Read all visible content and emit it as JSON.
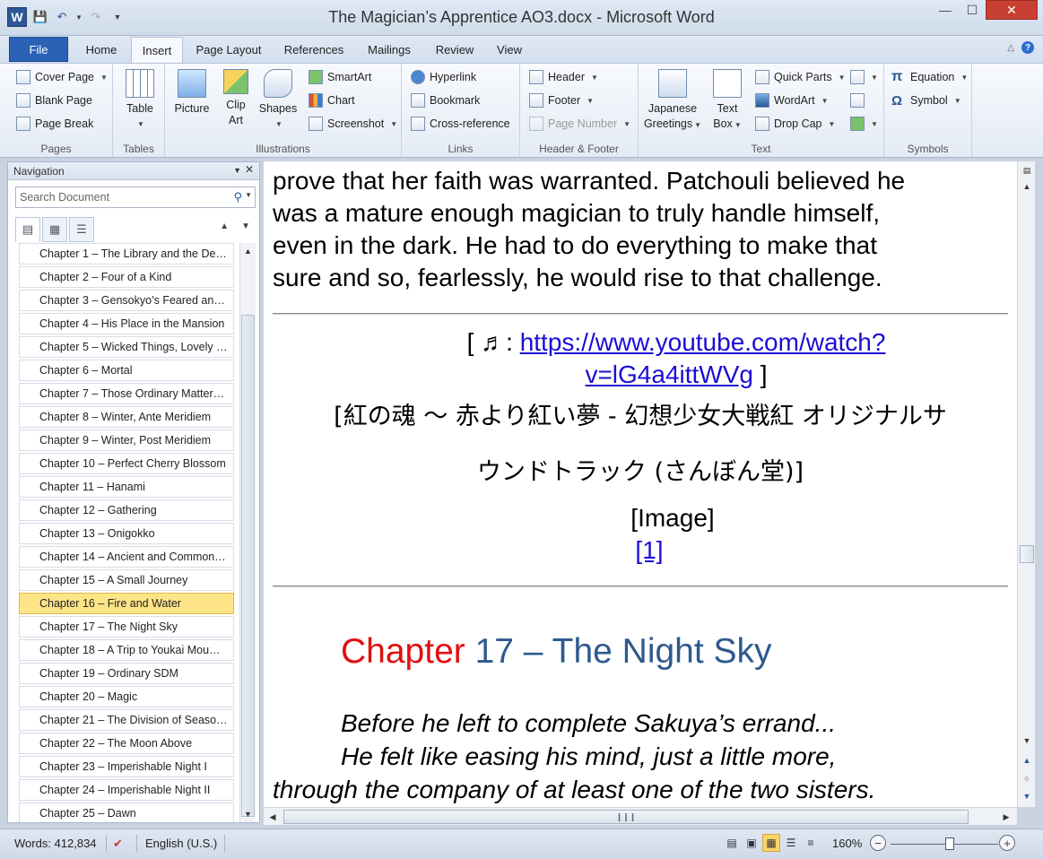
{
  "window": {
    "title": "The Magician’s Apprentice AO3.docx  -  Microsoft Word",
    "logo_letter": "W"
  },
  "ribbon": {
    "tabs": [
      "File",
      "Home",
      "Insert",
      "Page Layout",
      "References",
      "Mailings",
      "Review",
      "View"
    ],
    "active_tab": "Insert",
    "groups": {
      "pages": {
        "label": "Pages",
        "cover_page": "Cover Page",
        "blank_page": "Blank Page",
        "page_break": "Page Break"
      },
      "tables": {
        "label": "Tables",
        "table": "Table"
      },
      "illustrations": {
        "label": "Illustrations",
        "picture": "Picture",
        "clip_art_1": "Clip",
        "clip_art_2": "Art",
        "shapes": "Shapes",
        "smartart": "SmartArt",
        "chart": "Chart",
        "screenshot": "Screenshot"
      },
      "links": {
        "label": "Links",
        "hyperlink": "Hyperlink",
        "bookmark": "Bookmark",
        "cross_reference": "Cross-reference"
      },
      "header_footer": {
        "label": "Header & Footer",
        "header": "Header",
        "footer": "Footer",
        "page_number": "Page Number"
      },
      "text": {
        "label": "Text",
        "japanese_1": "Japanese",
        "japanese_2": "Greetings",
        "text_box_1": "Text",
        "text_box_2": "Box",
        "quick_parts": "Quick Parts",
        "wordart": "WordArt",
        "drop_cap": "Drop Cap"
      },
      "symbols": {
        "label": "Symbols",
        "equation": "Equation",
        "symbol": "Symbol"
      }
    }
  },
  "navigation": {
    "title": "Navigation",
    "search_placeholder": "Search Document",
    "headings": [
      "Chapter 1 – The Library and the De…",
      "Chapter 2 – Four of a Kind",
      "Chapter 3 – Gensokyo’s Feared an…",
      "Chapter 4 – His Place in the Mansion",
      "Chapter 5 – Wicked Things, Lovely …",
      "Chapter 6 – Mortal",
      "Chapter 7 – Those Ordinary Matter…",
      "Chapter 8 – Winter, Ante Meridiem",
      "Chapter 9 – Winter, Post Meridiem",
      "Chapter 10 – Perfect Cherry Blossom",
      "Chapter 11 – Hanami",
      "Chapter 12 – Gathering",
      "Chapter 13 – Onigokko",
      "Chapter 14 – Ancient and Common…",
      "Chapter 15 – A Small Journey",
      "Chapter 16 – Fire and Water",
      "Chapter 17 – The Night Sky",
      "Chapter 18 – A Trip to Youkai Mou…",
      "Chapter 19 – Ordinary SDM",
      "Chapter 20 – Magic",
      "Chapter 21 – The Division of Seaso…",
      "Chapter 22 – The Moon Above",
      "Chapter 23 – Imperishable Night I",
      "Chapter 24 – Imperishable Night II",
      "Chapter 25 – Dawn"
    ],
    "selected_index": 15
  },
  "document": {
    "para1": [
      "prove that her faith was warranted. Patchouli believed he",
      "was a mature enough magician to truly handle himself,",
      "even in the dark. He had to do everything to make that",
      "sure and so, fearlessly, he would rise to that challenge."
    ],
    "music_open": "[ ♬: ",
    "music_url_1": "https://www.youtube.com/watch?",
    "music_url_2": "v=lG4a4ittWVg",
    "music_close": " ]",
    "jp_line_1": "[紅の魂 〜 赤より紅い夢 - 幻想少女大戦紅 オリジナルサ",
    "jp_line_2": "ウンドトラック (さんぼん堂)]",
    "image_placeholder": "[Image]",
    "footnote": "[1]",
    "chapter_word": "Chapter",
    "chapter_rest": " 17 – The Night Sky",
    "italic_1": "Before he left to complete Sakuya’s errand...",
    "italic_2": "He felt like easing his mind, just a little more,",
    "italic_3": "through the company of at least one of the two sisters."
  },
  "statusbar": {
    "words": "Words: 412,834",
    "language": "English (U.S.)",
    "zoom": "160%"
  }
}
